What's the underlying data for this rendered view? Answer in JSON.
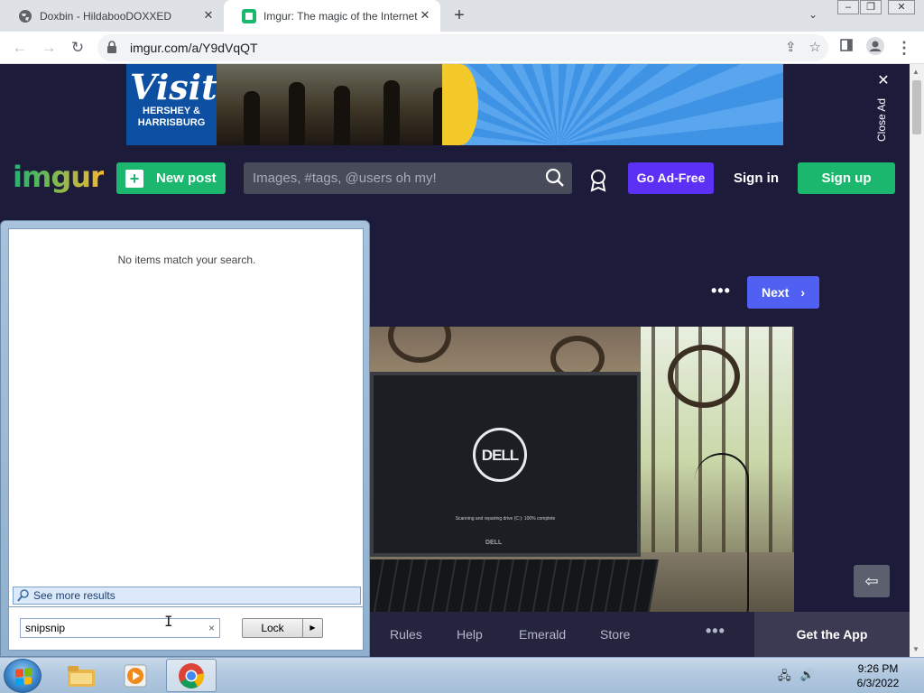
{
  "browser": {
    "tabs": [
      {
        "title": "Doxbin - HildabooDOXXED",
        "active": false
      },
      {
        "title": "Imgur: The magic of the Internet",
        "active": true
      }
    ],
    "url": "imgur.com/a/Y9dVqQT",
    "window_controls": {
      "minimize": "–",
      "maximize": "❐",
      "close": "✕"
    }
  },
  "ad": {
    "visit": "Visit",
    "place_line1": "HERSHEY &",
    "place_line2": "HARRISBURG",
    "close_label": "Close Ad",
    "close_x": "✕"
  },
  "imgur_header": {
    "logo": "imgur",
    "new_post": "New post",
    "search_placeholder": "Images, #tags, @users oh my!",
    "go_ad_free": "Go Ad-Free",
    "sign_in": "Sign in",
    "sign_up": "Sign up"
  },
  "post": {
    "more": "•••",
    "next": "Next",
    "image_texts": {
      "logo": "DELL",
      "scan_line": "Scanning and repairing drive (C:): 100% complete",
      "brand": "DELL"
    }
  },
  "footer": {
    "links": [
      "Rules",
      "Help",
      "Emerald",
      "Store"
    ],
    "more": "•••",
    "get_app": "Get the App"
  },
  "start_menu": {
    "no_items": "No items match your search.",
    "see_more": "See more results",
    "search_value": "snipsnip",
    "clear": "×",
    "lock_label": "Lock",
    "lock_arrow": "▶"
  },
  "taskbar": {
    "time": "9:26 PM",
    "date": "6/3/2022"
  },
  "colors": {
    "imgur_bg": "#1c1b3a",
    "imgur_green": "#1bb76e",
    "ad_free_purple": "#5c30f5",
    "next_blue": "#4f60f2"
  }
}
